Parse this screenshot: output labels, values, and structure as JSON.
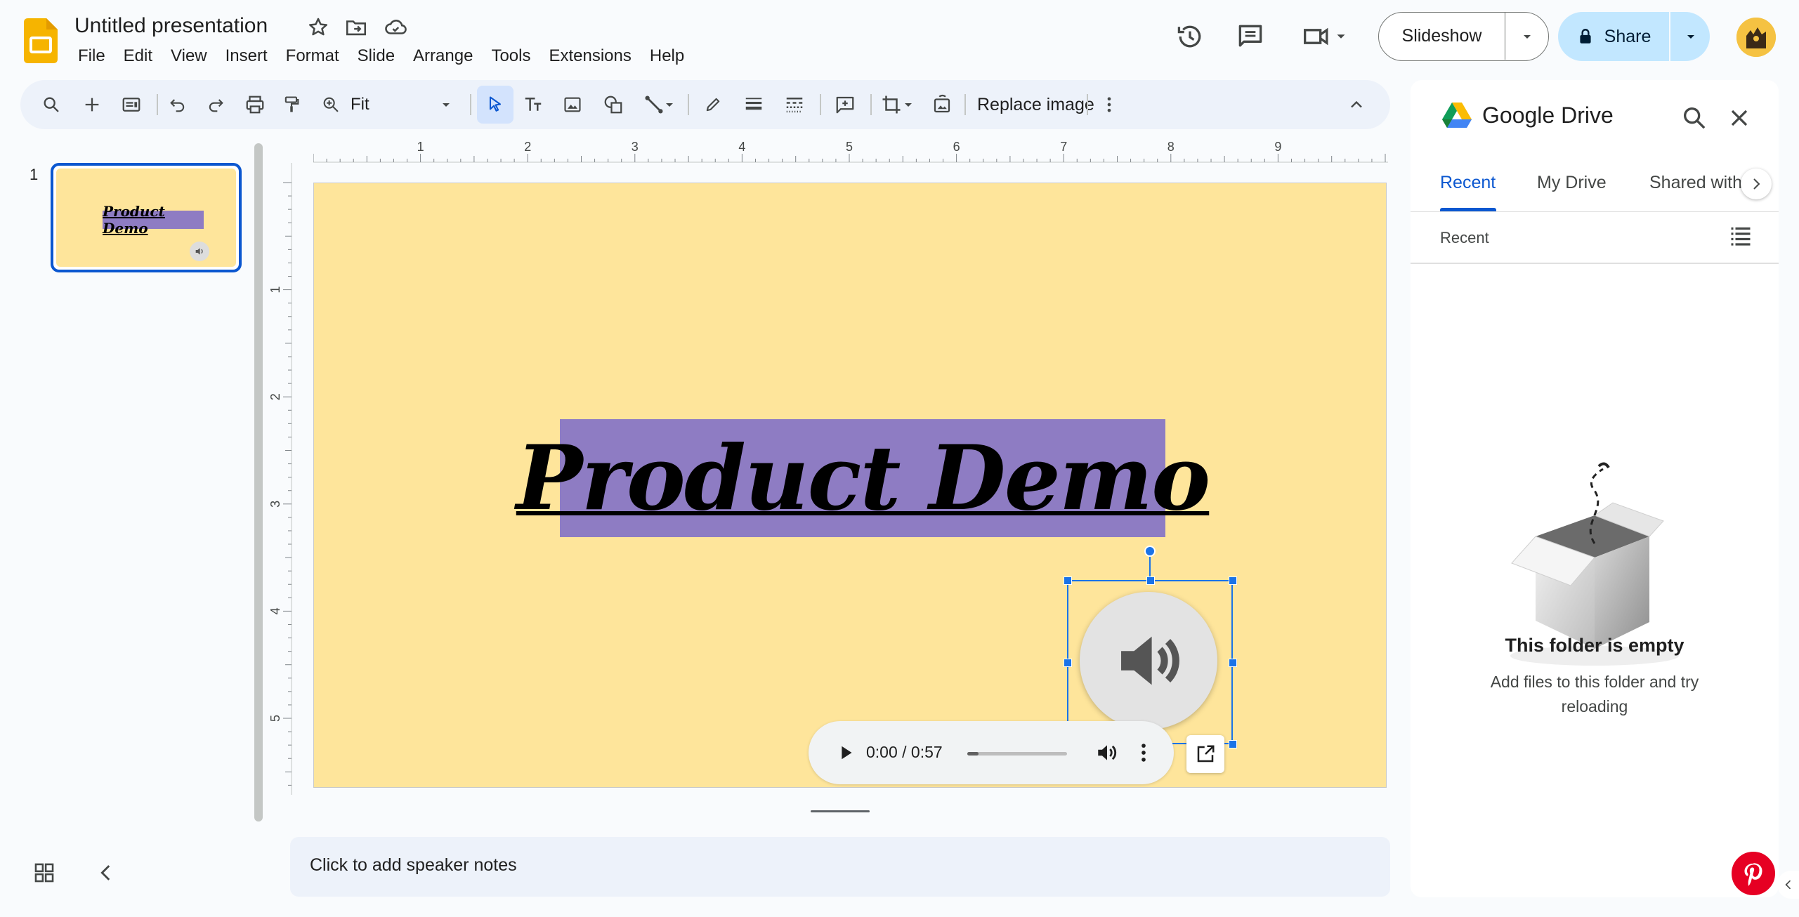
{
  "app": {
    "title": "Untitled presentation",
    "accent_color": "#0b57d0",
    "brand_color": "#f6b400"
  },
  "menubar": [
    "File",
    "Edit",
    "View",
    "Insert",
    "Format",
    "Slide",
    "Arrange",
    "Tools",
    "Extensions",
    "Help"
  ],
  "header": {
    "slideshow_label": "Slideshow",
    "share_label": "Share"
  },
  "toolbar": {
    "zoom_value": "Fit",
    "replace_image_label": "Replace image"
  },
  "filmstrip": {
    "slide_number": "1",
    "thumb_title": "Product Demo"
  },
  "ruler": {
    "horizontal_marks": [
      "1",
      "2",
      "3",
      "4",
      "5",
      "6",
      "7",
      "8",
      "9"
    ],
    "vertical_marks": [
      "1",
      "2",
      "3",
      "4",
      "5"
    ]
  },
  "slide": {
    "background_color": "#fee59b",
    "title_text": "Product Demo",
    "title_box_color": "#8e7cc3",
    "audio_player": {
      "time": "0:00 / 0:57",
      "progress": 0.0
    }
  },
  "notes": {
    "placeholder": "Click to add speaker notes"
  },
  "drive_panel": {
    "title": "Google Drive",
    "tabs": [
      "Recent",
      "My Drive",
      "Shared with me"
    ],
    "active_tab": "Recent",
    "section_label": "Recent",
    "empty_title": "This folder is empty",
    "empty_desc": "Add files to this folder and try reloading"
  }
}
